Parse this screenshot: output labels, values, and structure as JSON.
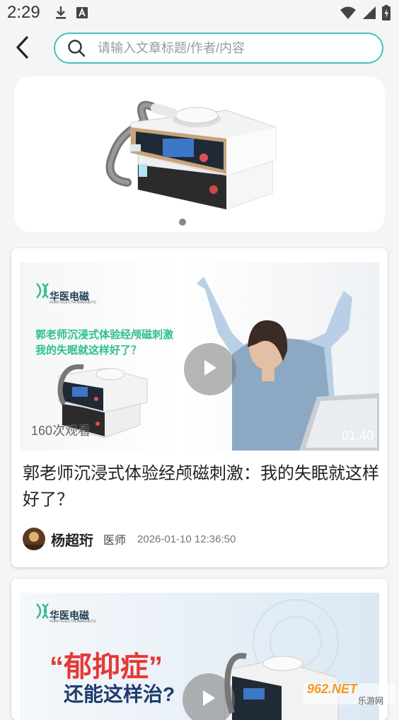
{
  "status_bar": {
    "time": "2:29"
  },
  "header": {
    "search_placeholder": "请输入文章标题/作者/内容"
  },
  "banner": {
    "page_count": 1,
    "active_index": 0
  },
  "articles": [
    {
      "thumb_brand": "华医电磁",
      "thumb_brand_sub": "HUAYI ELECTROMAGNETIC",
      "thumb_caption_line1": "郭老师沉浸式体验经颅磁刺激",
      "thumb_caption_line2": "我的失眠就这样好了？",
      "views": "160次观看",
      "duration": "01:40",
      "title": "郭老师沉浸式体验经颅磁刺激：我的失眠就这样好了？",
      "author": "杨超珩",
      "role": "医师",
      "time": "2026-01-10 12:36:50"
    },
    {
      "thumb_brand": "华医电磁",
      "thumb_brand_sub": "HUAYI ELECTROMAGNETIC",
      "thumb_headline_1": "“郁抑症”",
      "thumb_headline_2": "还能这样治?"
    }
  ],
  "watermark": {
    "text_1": "962.NET",
    "text_2": "乐游网"
  },
  "colors": {
    "accent": "#3ec4c0",
    "brand_green": "#2fbf8c",
    "brand_red": "#e53935"
  }
}
